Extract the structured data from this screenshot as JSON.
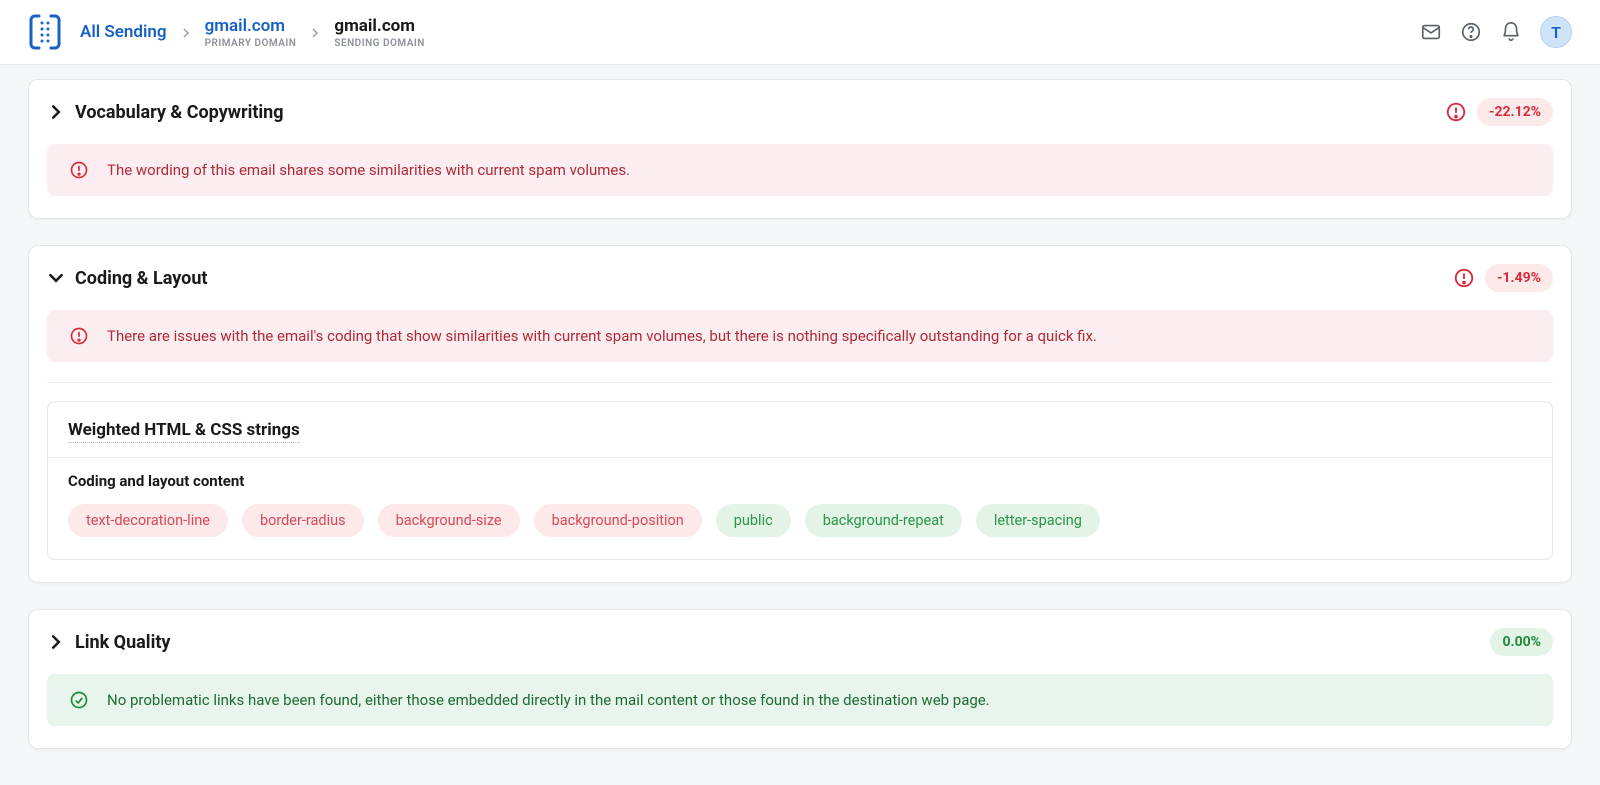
{
  "breadcrumb": {
    "root": "All Sending",
    "primary": {
      "label": "gmail.com",
      "sub": "PRIMARY DOMAIN"
    },
    "sending": {
      "label": "gmail.com",
      "sub": "SENDING DOMAIN"
    }
  },
  "avatar_letter": "T",
  "sections": {
    "vocab": {
      "title": "Vocabulary & Copywriting",
      "badge": "-22.12%",
      "banner": "The wording of this email shares some similarities with current spam volumes."
    },
    "coding": {
      "title": "Coding & Layout",
      "badge": "-1.49%",
      "banner": "There are issues with the email's coding that show similarities with current spam volumes, but there is nothing specifically outstanding for a quick fix.",
      "subpanel_title": "Weighted HTML & CSS strings",
      "subpanel_label": "Coding and layout content",
      "chips": [
        {
          "text": "text-decoration-line",
          "kind": "red"
        },
        {
          "text": "border-radius",
          "kind": "red"
        },
        {
          "text": "background-size",
          "kind": "red"
        },
        {
          "text": "background-position",
          "kind": "red"
        },
        {
          "text": "public",
          "kind": "green"
        },
        {
          "text": "background-repeat",
          "kind": "green"
        },
        {
          "text": "letter-spacing",
          "kind": "green"
        }
      ]
    },
    "link": {
      "title": "Link Quality",
      "badge": "0.00%",
      "banner": "No problematic links have been found, either those embedded directly in the mail content or those found in the destination web page."
    }
  }
}
